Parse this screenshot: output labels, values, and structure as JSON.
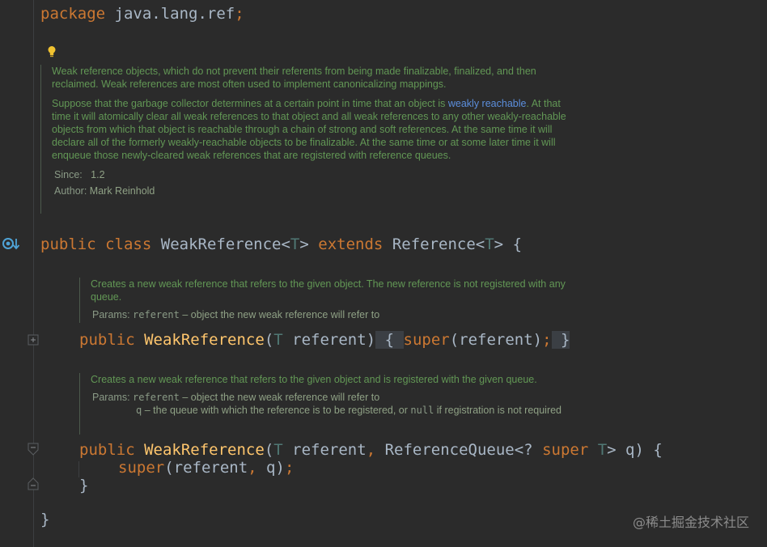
{
  "editor": {
    "language": "java",
    "theme_colors": {
      "background": "#2b2b2b",
      "keyword": "#cc7832",
      "identifier": "#a9b7c6",
      "method": "#ffc66d",
      "type_param": "#507874",
      "doc_text": "#629755",
      "doc_link": "#5c8fdd"
    }
  },
  "package_line": {
    "keyword": "package",
    "name": "java.lang.ref",
    "semicolon": ";"
  },
  "class_doc": {
    "para1": "Weak reference objects, which do not prevent their referents from being made finalizable, finalized, and then reclaimed. Weak references are most often used to implement canonicalizing mappings.",
    "para2_before_link": "Suppose that the garbage collector determines at a certain point in time that an object is ",
    "para2_link": "weakly reachable",
    "para2_after_link": ". At that time it will atomically clear all weak references to that object and all weak references to any other weakly-reachable objects from which that object is reachable through a chain of strong and soft references. At the same time it will declare all of the formerly weakly-reachable objects to be finalizable. At the same time or at some later time it will enqueue those newly-cleared weak references that are registered with reference queues.",
    "since_label": "Since:",
    "since_value": "1.2",
    "author_label": "Author:",
    "author_value": "Mark Reinhold"
  },
  "class_decl": {
    "public": "public",
    "class": "class",
    "name": "WeakReference",
    "lt": "<",
    "type_param": "T",
    "gt": ">",
    "extends": "extends",
    "super_name": "Reference",
    "open_brace": "{"
  },
  "ctor1_doc": {
    "text": "Creates a new weak reference that refers to the given object. The new reference is not registered with any queue.",
    "params_label": "Params:",
    "param_name": "referent",
    "param_desc": "– object the new weak reference will refer to"
  },
  "ctor1": {
    "public": "public",
    "name": "WeakReference",
    "open_paren": "(",
    "type": "T",
    "arg": "referent",
    "close_paren": ")",
    "open_brace": "{",
    "super_kw": "super",
    "super_args": "(referent)",
    "semicolon": ";",
    "close_brace": "}"
  },
  "ctor2_doc": {
    "text": "Creates a new weak reference that refers to the given object and is registered with the given queue.",
    "params_label": "Params:",
    "param1_name": "referent",
    "param1_desc": "– object the new weak reference will refer to",
    "param2_name": "q",
    "param2_desc_before": "– the queue with which the reference is to be registered, or ",
    "param2_null": "null",
    "param2_desc_after": " if registration is not required"
  },
  "ctor2": {
    "public": "public",
    "name": "WeakReference",
    "open_paren": "(",
    "type1": "T",
    "arg1": "referent",
    "comma": ",",
    "rq": "ReferenceQueue<? ",
    "super_kw": "super",
    "type2": "T",
    "rest": "> q) {",
    "body_super": "super",
    "body_args_open": "(referent",
    "body_comma": ",",
    "body_args_close": " q)",
    "body_semicolon": ";",
    "close_brace": "}"
  },
  "class_close": "}",
  "watermark": "@稀土掘金技术社区"
}
